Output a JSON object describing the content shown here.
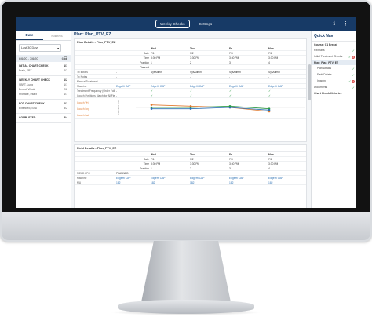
{
  "topbar": {
    "tabs": [
      "Weekly Checks",
      "Settings"
    ],
    "active_tab": "Weekly Checks"
  },
  "left": {
    "tabs": [
      "Date",
      "Patient"
    ],
    "range_select": "Last 30 Days",
    "date_range": "6/6/20 - 7/6/20",
    "date_count": "6 / 6",
    "groups": [
      {
        "title": "INITIAL CHART CHECK",
        "count": "1/1",
        "items": [
          {
            "name": "Brain, SRT",
            "count": "2/2"
          }
        ]
      },
      {
        "title": "WEEKLY CHART CHECK",
        "count": "1/2",
        "items": [
          {
            "name": "SBRT, Lung",
            "count": "1/1"
          },
          {
            "name": "Breast, Whole",
            "count": "2/2"
          },
          {
            "name": "Prostate, Intact",
            "count": "1/1"
          }
        ]
      },
      {
        "title": "EOT CHART CHECK",
        "count": "0/1",
        "items": [
          {
            "name": "Extended, SSD",
            "count": "3/2"
          }
        ]
      },
      {
        "title": "COMPLETED",
        "count": "3/4",
        "items": []
      }
    ]
  },
  "main": {
    "title": "Plan: Plan_PTV_EZ",
    "plan_card": {
      "header": "Plan Details - Plan_PTV_EZ",
      "cols": [
        "",
        "",
        "Wed",
        "Thu",
        "Fri",
        "Mon"
      ],
      "subrows": [
        [
          "",
          "Date",
          "7/1",
          "7/2",
          "7/3",
          "7/6"
        ],
        [
          "",
          "Time",
          "3:30 PM",
          "3:30 PM",
          "3:30 PM",
          "3:30 PM"
        ],
        [
          "",
          "Fraction",
          "1",
          "2",
          "3",
          "4"
        ],
        [
          "",
          "Planned",
          "",
          "",
          "",
          ""
        ]
      ],
      "rows": [
        [
          "Tx Initials",
          "-",
          "SysAdmin",
          "SysAdmin",
          "SysAdmin",
          "SysAdmin"
        ],
        [
          "Tx Notes",
          "-",
          "-",
          "-",
          "-",
          "-"
        ],
        [
          "Manual Treatment",
          "-",
          "-",
          "-",
          "-",
          "-"
        ],
        [
          "Machine",
          "EdgeHi CAP",
          "EdgeHi CAP",
          "EdgeHi CAP",
          "EdgeHi CAP",
          "EdgeHi CAP"
        ],
        [
          "Treatment Frequency (Order Followed)",
          "-",
          "✓",
          "✓",
          "✓",
          "✓"
        ],
        [
          "Couch Positions Match for All Fields",
          "-",
          "✓",
          "✓",
          "✓",
          "✓"
        ]
      ],
      "couch_labels": [
        "Couch Vrt",
        "Couch Lng",
        "Couch Lat"
      ],
      "couch_axis": "Δ Position (cm)",
      "chart_data": {
        "type": "line",
        "x": [
          "7/1",
          "7/2",
          "7/3",
          "7/6"
        ],
        "series": [
          {
            "name": "Couch Vrt",
            "values": [
              0.2,
              0.1,
              0.0,
              -0.3
            ]
          },
          {
            "name": "Couch Lng",
            "values": [
              0.0,
              0.0,
              0.1,
              -0.1
            ]
          },
          {
            "name": "Couch Lat",
            "values": [
              -0.1,
              -0.1,
              0.0,
              -0.2
            ]
          }
        ],
        "ylim": [
          -0.6,
          0.6
        ]
      }
    },
    "field_card": {
      "header": "Field Details - Plan_PTV_EZ",
      "cols": [
        "",
        "",
        "Wed",
        "Thu",
        "Fri",
        "Mon"
      ],
      "subrows": [
        [
          "",
          "Date",
          "7/1",
          "7/2",
          "7/3",
          "7/6"
        ],
        [
          "",
          "Time",
          "3:30 PM",
          "3:30 PM",
          "3:30 PM",
          "3:30 PM"
        ],
        [
          "",
          "Fraction",
          "1",
          "2",
          "3",
          "4"
        ]
      ],
      "rows": [
        [
          "FIELD LPO",
          "PLANNED",
          "",
          "",
          "",
          ""
        ],
        [
          "Machine",
          "EdgeHi CAP",
          "EdgeHi CAP",
          "EdgeHi CAP",
          "EdgeHi CAP",
          "EdgeHi CAP"
        ],
        [
          "MU",
          "182",
          "182",
          "182",
          "182",
          "182"
        ]
      ]
    }
  },
  "right": {
    "title": "Quick Nav",
    "items": [
      {
        "label": "Course: C1 Breast",
        "kind": "h"
      },
      {
        "label": "Rx/Plans",
        "kind": "i",
        "status": "✓"
      },
      {
        "label": "Initial Treatment Checks",
        "kind": "i",
        "status": "✓",
        "badge": "2"
      },
      {
        "label": "Plan: Plan_PTV_EZ",
        "kind": "h"
      },
      {
        "label": "Plan Details",
        "kind": "s",
        "status": "✓"
      },
      {
        "label": "Field Details",
        "kind": "s",
        "status": "✓"
      },
      {
        "label": "Imaging",
        "kind": "s",
        "status": "✓",
        "badge": "2"
      },
      {
        "label": "Documents",
        "kind": "i",
        "status": "✓"
      },
      {
        "label": "Chart Check Histories",
        "kind": "h"
      }
    ]
  },
  "colors": {
    "navy": "#173a66",
    "check": "#2e9b46",
    "badge": "#d9534f"
  }
}
